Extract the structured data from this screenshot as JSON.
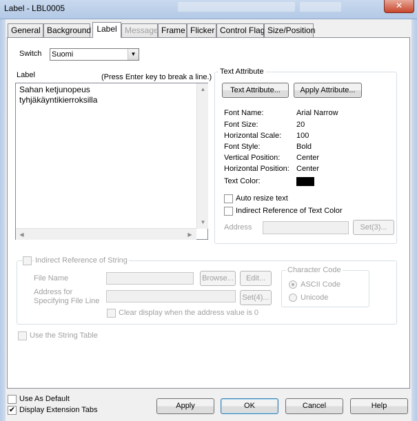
{
  "window": {
    "title": "Label - LBL0005",
    "close_glyph": "✕"
  },
  "tabs": [
    {
      "label": "General"
    },
    {
      "label": "Background"
    },
    {
      "label": "Label"
    },
    {
      "label": "Message"
    },
    {
      "label": "Frame"
    },
    {
      "label": "Flicker"
    },
    {
      "label": "Control Flag"
    },
    {
      "label": "Size/Position"
    }
  ],
  "switch": {
    "label": "Switch",
    "value": "Suomi"
  },
  "label_section": {
    "label": "Label",
    "hint": "(Press Enter key to break a line.)",
    "text": "Sahan ketjunopeus\ntyhjäkäyntikierroksilla"
  },
  "text_attribute": {
    "title": "Text Attribute",
    "text_attribute_button": "Text Attribute...",
    "apply_attribute_button": "Apply Attribute...",
    "font_name_label": "Font Name:",
    "font_name": "Arial Narrow",
    "font_size_label": "Font Size:",
    "font_size": "20",
    "horizontal_scale_label": "Horizontal Scale:",
    "horizontal_scale": "100",
    "font_style_label": "Font Style:",
    "font_style": "Bold",
    "vertical_position_label": "Vertical Position:",
    "vertical_position": "Center",
    "horizontal_position_label": "Horizontal Position:",
    "horizontal_position": "Center",
    "text_color_label": "Text Color:",
    "text_color": "#000000",
    "auto_resize_label": "Auto resize text",
    "indirect_color_label": "Indirect Reference of Text Color",
    "address_label": "Address",
    "set3_button": "Set(3)..."
  },
  "indirect_string": {
    "title": "Indirect Reference of String",
    "file_name_label": "File Name",
    "browse_button": "Browse...",
    "edit_button": "Edit...",
    "address_label_line1": "Address for",
    "address_label_line2": "Specifying File Line",
    "set4_button": "Set(4)...",
    "clear_display_label": "Clear display when the address value is 0",
    "character_code_title": "Character Code",
    "ascii_label": "ASCII Code",
    "unicode_label": "Unicode"
  },
  "use_string_table_label": "Use the String Table",
  "footer": {
    "use_as_default_label": "Use As Default",
    "display_extension_tabs_label": "Display Extension Tabs",
    "display_extension_tabs_checked": "✔",
    "apply_button": "Apply",
    "ok_button": "OK",
    "cancel_button": "Cancel",
    "help_button": "Help"
  }
}
